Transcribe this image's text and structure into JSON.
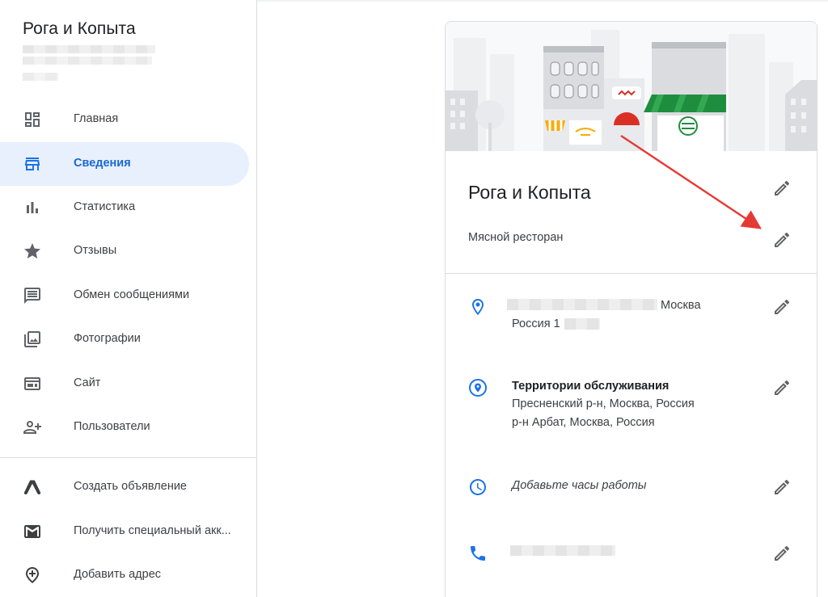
{
  "sidebar": {
    "business_name": "Рога и Копыта",
    "items": [
      {
        "label": "Главная",
        "icon": "dashboard-icon"
      },
      {
        "label": "Сведения",
        "icon": "storefront-icon",
        "active": true
      },
      {
        "label": "Статистика",
        "icon": "bar-chart-icon"
      },
      {
        "label": "Отзывы",
        "icon": "star-icon"
      },
      {
        "label": "Обмен сообщениями",
        "icon": "message-icon"
      },
      {
        "label": "Фотографии",
        "icon": "photo-library-icon"
      },
      {
        "label": "Сайт",
        "icon": "website-icon"
      },
      {
        "label": "Пользователи",
        "icon": "person-add-icon"
      }
    ],
    "bottom_items": [
      {
        "label": "Создать объявление",
        "icon": "google-ads-icon"
      },
      {
        "label": "Получить специальный акк...",
        "icon": "gmail-icon"
      },
      {
        "label": "Добавить адрес",
        "icon": "add-location-icon"
      }
    ]
  },
  "card": {
    "title": "Рога и Копыта",
    "category": "Мясной ресторан",
    "address": {
      "line1_suffix": "Москва",
      "line2_prefix": "Россия 1"
    },
    "service_area": {
      "heading": "Территории обслуживания",
      "line1": "Пресненский р-н, Москва, Россия",
      "line2": "р-н Арбат, Москва, Россия"
    },
    "hours_placeholder": "Добавьте часы работы"
  },
  "colors": {
    "accent": "#1a73e8",
    "active_bg": "#e8f0fe",
    "active_text": "#1967d2",
    "arrow": "#e53935",
    "awning_green": "#1e8e3e",
    "awning_red": "#d93025",
    "awning_yellow": "#f9ab00"
  }
}
